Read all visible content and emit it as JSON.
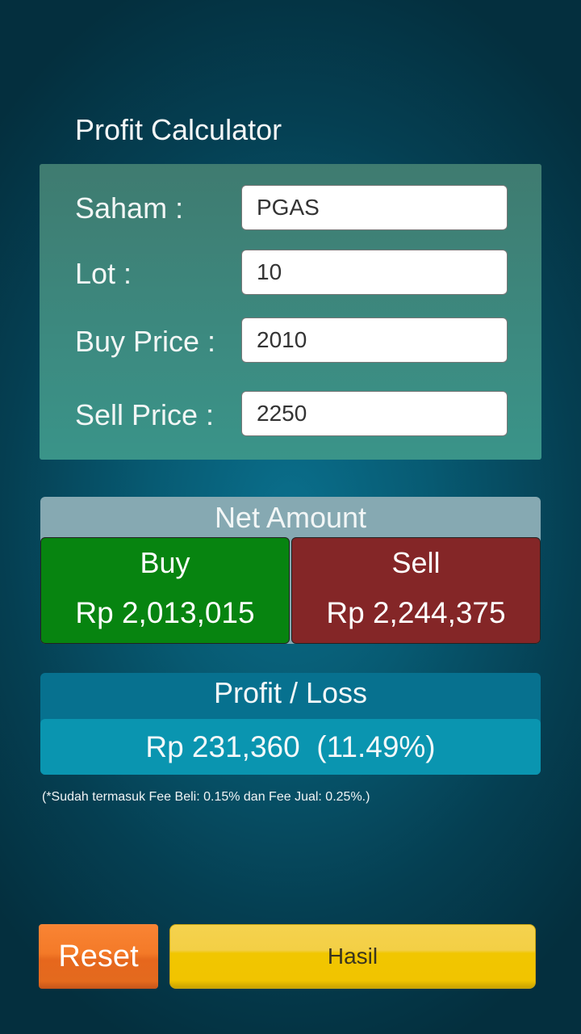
{
  "header": {
    "title": "Profit Calculator"
  },
  "form": {
    "saham": {
      "label": "Saham :",
      "value": "PGAS"
    },
    "lot": {
      "label": "Lot :",
      "value": "10"
    },
    "buy_price": {
      "label": "Buy Price :",
      "value": "2010"
    },
    "sell_price": {
      "label": "Sell Price :",
      "value": "2250"
    }
  },
  "net_amount": {
    "title": "Net Amount",
    "buy": {
      "label": "Buy",
      "value": "Rp 2,013,015",
      "color": "#078410"
    },
    "sell": {
      "label": "Sell",
      "value": "Rp 2,244,375",
      "color": "#842627"
    }
  },
  "profit_loss": {
    "title": "Profit / Loss",
    "value": "Rp 231,360  (11.49%)"
  },
  "note": "(*Sudah termasuk Fee Beli: 0.15% dan Fee Jual: 0.25%.)",
  "buttons": {
    "reset": "Reset",
    "hasil": "Hasil"
  }
}
